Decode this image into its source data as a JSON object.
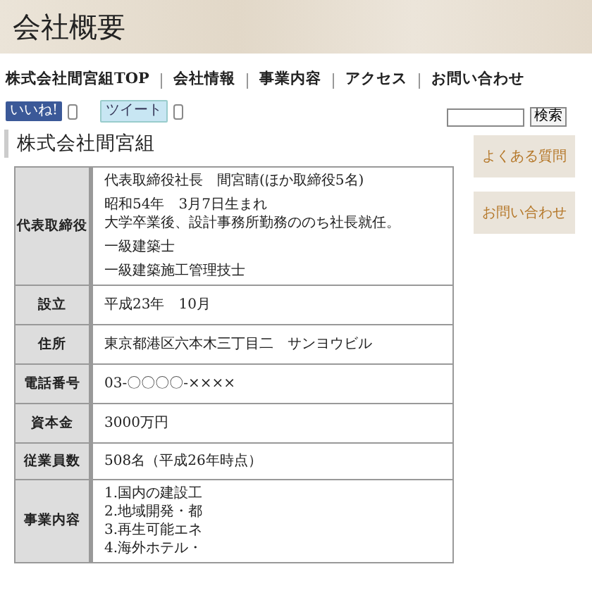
{
  "header": {
    "title": "会社概要"
  },
  "nav": [
    {
      "label": "株式会社間宮組TOP"
    },
    {
      "label": "会社情報"
    },
    {
      "label": "事業内容"
    },
    {
      "label": "アクセス"
    },
    {
      "label": "お問い合わせ"
    }
  ],
  "social": [
    {
      "kind": "like",
      "label": "いいね!"
    },
    {
      "kind": "tweet",
      "label": "ツイート"
    }
  ],
  "search": {
    "button": "検索"
  },
  "section_title": "株式会社間宮組",
  "table": [
    {
      "label": "代表取締役",
      "paragraphs": [
        [
          "代表取締役社長　間宮睛(ほか取締役5名)"
        ],
        [
          "昭和54年　3月7日生まれ",
          "大学卒業後、設計事務所勤務ののち社長就任。"
        ],
        [
          "一級建築士"
        ],
        [
          "一級建築施工管理技士"
        ]
      ]
    },
    {
      "label": "設立",
      "paragraphs": [
        [
          "平成23年　10月"
        ]
      ]
    },
    {
      "label": "住所",
      "paragraphs": [
        [
          "東京都港区六本木三丁目二　サンヨウビル"
        ]
      ]
    },
    {
      "label": "電話番号",
      "paragraphs": [
        [
          "03-〇〇〇〇-××××"
        ]
      ]
    },
    {
      "label": "資本金",
      "paragraphs": [
        [
          "3000万円"
        ]
      ]
    },
    {
      "label": "従業員数",
      "paragraphs": [
        [
          "508名（平成26年時点）"
        ]
      ]
    },
    {
      "label": "事業内容",
      "paragraphs": [
        [
          "1.国内の建設工",
          "2.地域開発・都",
          "3.再生可能エネ",
          "4.海外ホテル・"
        ]
      ]
    }
  ],
  "side_buttons": [
    {
      "label": "よくある質問"
    },
    {
      "label": "お問い合わせ"
    }
  ]
}
